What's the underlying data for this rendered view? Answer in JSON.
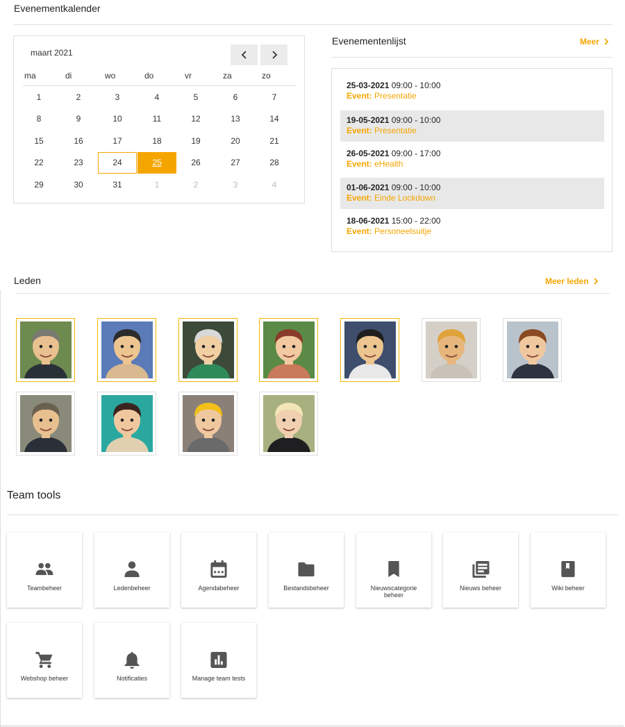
{
  "calendar": {
    "title": "Evenementkalender",
    "month_label": "maart 2021",
    "weekdays": [
      "ma",
      "di",
      "wo",
      "do",
      "vr",
      "za",
      "zo"
    ],
    "weeks": [
      [
        {
          "d": "1"
        },
        {
          "d": "2"
        },
        {
          "d": "3"
        },
        {
          "d": "4"
        },
        {
          "d": "5"
        },
        {
          "d": "6"
        },
        {
          "d": "7"
        }
      ],
      [
        {
          "d": "8"
        },
        {
          "d": "9"
        },
        {
          "d": "10"
        },
        {
          "d": "11"
        },
        {
          "d": "12"
        },
        {
          "d": "13"
        },
        {
          "d": "14"
        }
      ],
      [
        {
          "d": "15"
        },
        {
          "d": "16"
        },
        {
          "d": "17"
        },
        {
          "d": "18"
        },
        {
          "d": "19"
        },
        {
          "d": "20"
        },
        {
          "d": "21"
        }
      ],
      [
        {
          "d": "22"
        },
        {
          "d": "23"
        },
        {
          "d": "24",
          "state": "today"
        },
        {
          "d": "25",
          "state": "selected"
        },
        {
          "d": "26"
        },
        {
          "d": "27"
        },
        {
          "d": "28"
        }
      ],
      [
        {
          "d": "29"
        },
        {
          "d": "30"
        },
        {
          "d": "31"
        },
        {
          "d": "1",
          "state": "other"
        },
        {
          "d": "2",
          "state": "other"
        },
        {
          "d": "3",
          "state": "other"
        },
        {
          "d": "4",
          "state": "other"
        }
      ]
    ]
  },
  "events": {
    "title": "Evenementenlijst",
    "more_label": "Meer",
    "event_prefix": "Event:",
    "items": [
      {
        "date": "25-03-2021",
        "time": "09:00 - 10:00",
        "name": "Presentatie",
        "shaded": false
      },
      {
        "date": "19-05-2021",
        "time": "09:00 - 10:00",
        "name": "Presentatie",
        "shaded": true
      },
      {
        "date": "26-05-2021",
        "time": "09:00 - 17:00",
        "name": "eHealth",
        "shaded": false
      },
      {
        "date": "01-06-2021",
        "time": "09:00 - 10:00",
        "name": "Einde Lockdown",
        "shaded": true
      },
      {
        "date": "18-06-2021",
        "time": "15:00 - 22:00",
        "name": "Personeelsuitje",
        "shaded": false
      }
    ]
  },
  "members": {
    "title": "Leden",
    "more_label": "Meer leden",
    "items": [
      {
        "active": true,
        "bg": "#6d8a4f",
        "skin": "#e9c08f",
        "hair": "#7a7a72",
        "suit": "#2a3038"
      },
      {
        "active": true,
        "bg": "#5b7ab8",
        "skin": "#ecc590",
        "hair": "#2b2b2b",
        "suit": "#d9b98f"
      },
      {
        "active": true,
        "bg": "#3d4a3a",
        "skin": "#f0cfa3",
        "hair": "#d8d8d8",
        "suit": "#2f8a5a"
      },
      {
        "active": true,
        "bg": "#5a8a46",
        "skin": "#f2c9a0",
        "hair": "#8a3a2a",
        "suit": "#c97a5a"
      },
      {
        "active": true,
        "bg": "#3e4e6c",
        "skin": "#ecc590",
        "hair": "#1f1f1f",
        "suit": "#e8e8e8"
      },
      {
        "active": false,
        "bg": "#d4d0c8",
        "skin": "#e6b67c",
        "hair": "#e0a23a",
        "suit": "#c9c2b8"
      },
      {
        "active": false,
        "bg": "#b9c3cc",
        "skin": "#f0c8a0",
        "hair": "#8a4a22",
        "suit": "#2d3440"
      },
      {
        "active": false,
        "bg": "#8a8a7a",
        "skin": "#e8c090",
        "hair": "#6a6050",
        "suit": "#2a2f38"
      },
      {
        "active": false,
        "bg": "#2aa8a0",
        "skin": "#f0c8a0",
        "hair": "#3a2420",
        "suit": "#e0d0b0"
      },
      {
        "active": false,
        "bg": "#8a8078",
        "skin": "#efc8a0",
        "hair": "#f2c018",
        "suit": "#6a6a6a"
      },
      {
        "active": false,
        "bg": "#a8b080",
        "skin": "#f0d0b0",
        "hair": "#f2e6b8",
        "suit": "#1f1f22"
      }
    ]
  },
  "tools": {
    "title": "Team tools",
    "items": [
      {
        "label": "Teambeheer",
        "icon": "group-icon"
      },
      {
        "label": "Ledenbeheer",
        "icon": "person-icon"
      },
      {
        "label": "Agendabeheer",
        "icon": "calendar-icon"
      },
      {
        "label": "Bestandsbeheer",
        "icon": "folder-icon"
      },
      {
        "label": "Nieuwscategorie beheer",
        "icon": "bookmark-icon"
      },
      {
        "label": "Nieuws beheer",
        "icon": "news-icon"
      },
      {
        "label": "Wiki beheer",
        "icon": "book-icon"
      },
      {
        "label": "Webshop beheer",
        "icon": "cart-icon"
      },
      {
        "label": "Notificaties",
        "icon": "bell-icon"
      },
      {
        "label": "Manage team tests",
        "icon": "chart-icon"
      }
    ]
  },
  "colors": {
    "accent": "#f5a500",
    "icon": "#555555"
  }
}
